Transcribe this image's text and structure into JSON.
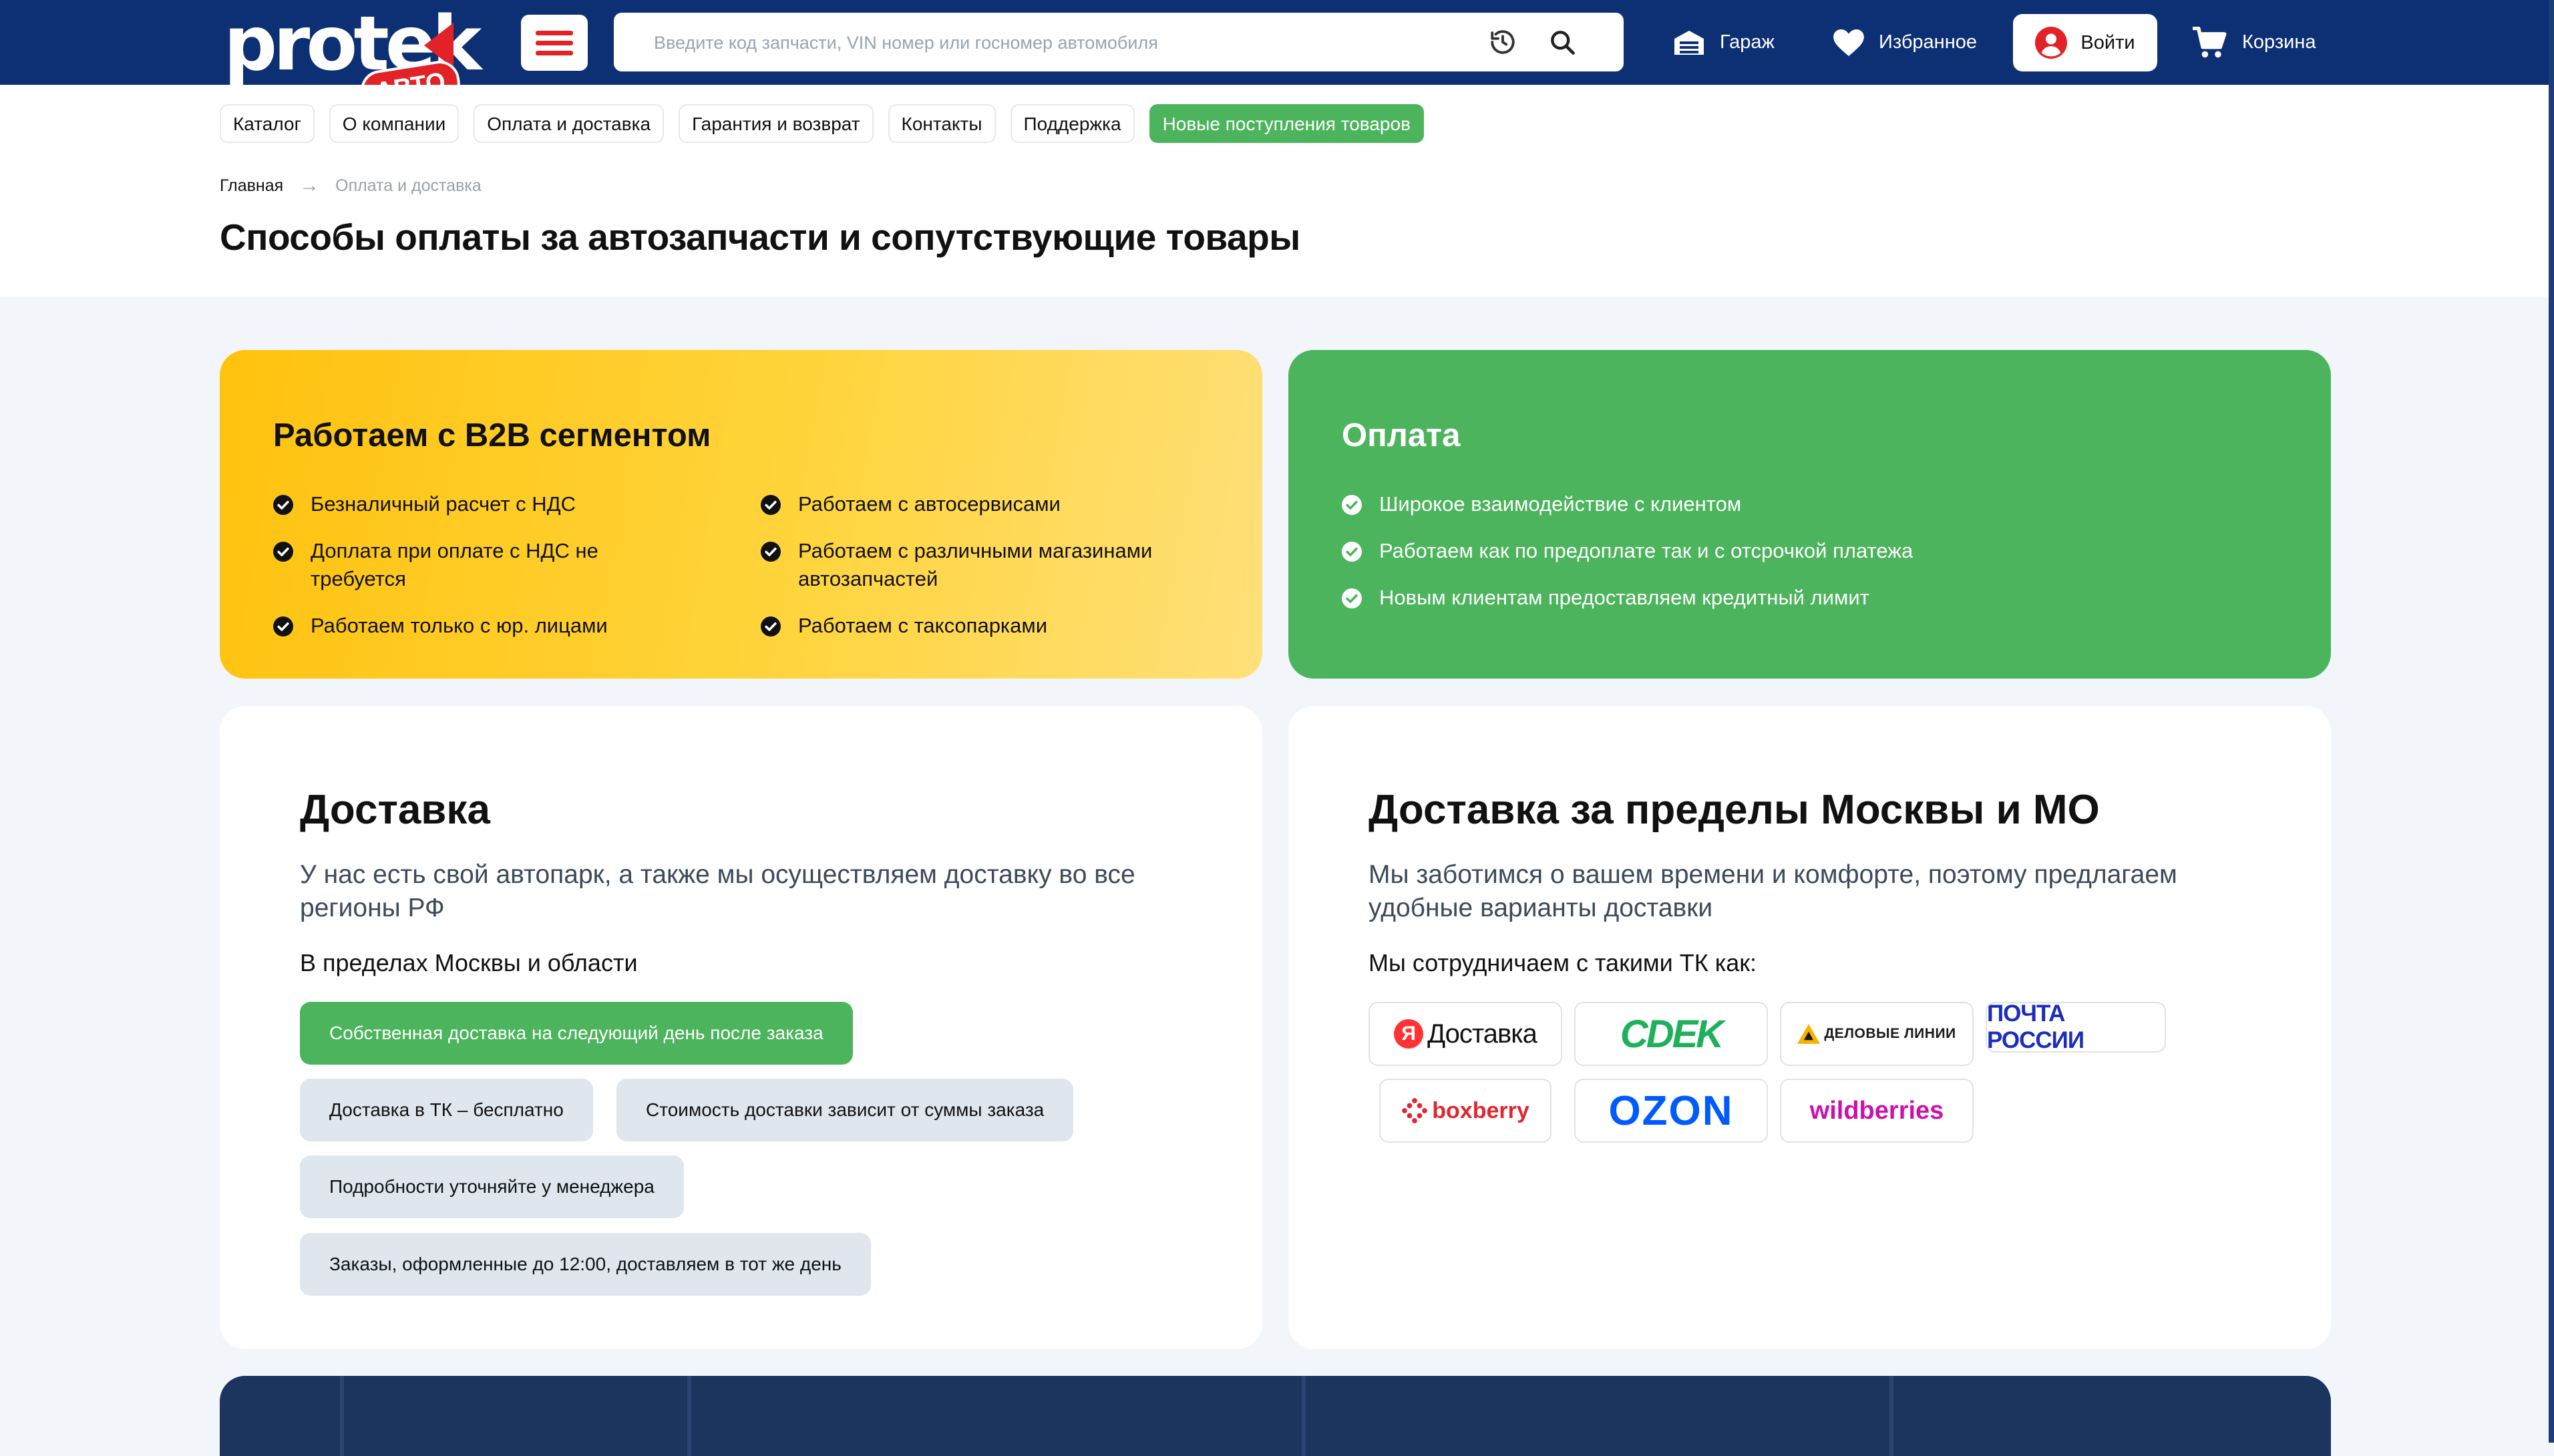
{
  "header": {
    "logo": {
      "word": "protek",
      "badge": "АВТО"
    },
    "search": {
      "placeholder": "Введите код запчасти, VIN номер или госномер автомобиля",
      "value": ""
    },
    "garage_label": "Гараж",
    "favorites_label": "Избранное",
    "login_label": "Войти",
    "cart_label": "Корзина"
  },
  "nav_pills": [
    {
      "label": "Каталог"
    },
    {
      "label": "О компании"
    },
    {
      "label": "Оплата и доставка"
    },
    {
      "label": "Гарантия и возврат"
    },
    {
      "label": "Контакты"
    },
    {
      "label": "Поддержка"
    },
    {
      "label": "Новые поступления товаров"
    }
  ],
  "breadcrumb": {
    "home": "Главная",
    "separator": "→",
    "current": "Оплата и доставка"
  },
  "page_title": "Способы оплаты за автозапчасти и сопутствующие товары",
  "b2b": {
    "title": "Работаем с B2B сегментом",
    "col1": [
      "Безналичный расчет с НДС",
      "Доплата при оплате с НДС не требуется",
      "Работаем только с юр. лицами"
    ],
    "col2": [
      "Работаем с автосервисами",
      "Работаем с различными магазинами автозапчастей",
      "Работаем с таксопарками"
    ]
  },
  "payment": {
    "title": "Оплата",
    "items": [
      "Широкое взаимодействие с клиентом",
      "Работаем как по предоплате так и с отсрочкой платежа",
      "Новым клиентам предоставляем кредитный лимит"
    ]
  },
  "delivery": {
    "title": "Доставка",
    "subtitle": "У нас есть свой автопарк, а также мы осуществляем доставку во все регионы РФ",
    "label": "В пределах Москвы и области",
    "chips": [
      "Собственная доставка на следующий день после заказа",
      "Доставка в ТК – бесплатно",
      "Стоимость доставки зависит от суммы заказа",
      "Подробности уточняйте у менеджера",
      "Заказы, оформленные до 12:00, доставляем в тот же день"
    ]
  },
  "delivery_outside": {
    "title": "Доставка за пределы Москвы и МО",
    "subtitle": "Мы заботимся о вашем времени и комфорте, поэтому предлагаем удобные варианты доставки",
    "label": "Мы сотрудничаем с такими ТК как:",
    "companies": [
      {
        "name": "Доставка",
        "mark": "Я"
      },
      {
        "name": "CDEK"
      },
      {
        "name": "ДЕЛОВЫЕ ЛИНИИ"
      },
      {
        "name": "ПОЧТА РОССИИ"
      },
      {
        "name": "boxberry"
      },
      {
        "name": "OZON"
      },
      {
        "name": "wildberries"
      }
    ]
  },
  "colors": {
    "header_bg": "#0d2f73",
    "accent_red": "#e32228",
    "green": "#4cb45c",
    "yellow": "#ffc20e"
  }
}
